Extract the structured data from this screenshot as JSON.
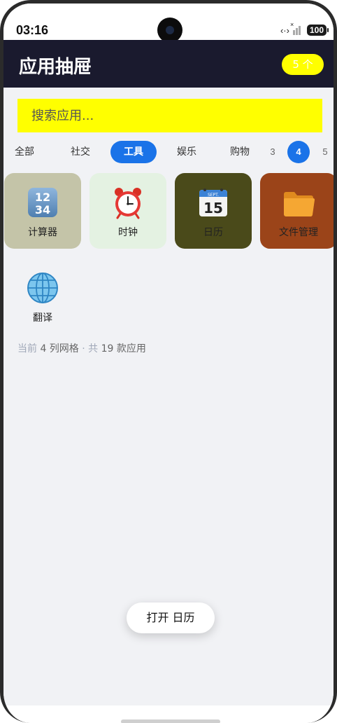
{
  "status_bar": {
    "time": "03:16",
    "battery": "100"
  },
  "header": {
    "title": "应用抽屉",
    "count_badge": "5 个",
    "background": "#1a1a2e",
    "badge_color": "#ffff00"
  },
  "search": {
    "placeholder": "搜索应用...",
    "value": ""
  },
  "categories": {
    "items": [
      "全部",
      "社交",
      "工具",
      "娱乐",
      "购物"
    ],
    "selected": "工具"
  },
  "columns": {
    "options": [
      "3",
      "4",
      "5"
    ],
    "selected": "4"
  },
  "apps": [
    {
      "name": "计算器",
      "icon": "calculator-icon",
      "tile_color": "#c4c4a8"
    },
    {
      "name": "时钟",
      "icon": "alarm-clock-icon",
      "tile_color": "#e4f2e2"
    },
    {
      "name": "日历",
      "icon": "calendar-icon",
      "tile_color": "#4a4a1a",
      "calendar_month": "SEPT.",
      "calendar_day": "15"
    },
    {
      "name": "文件管理",
      "icon": "folder-icon",
      "tile_color": "#9b4419"
    },
    {
      "name": "翻译",
      "icon": "globe-icon",
      "tile_color": "#f1f2f5"
    }
  ],
  "footer": {
    "prefix": "当前",
    "columns_text": "4 列网格",
    "separator": "·",
    "total_prefix": "共",
    "total_text": "19 款应用"
  },
  "toast": {
    "text": "打开 日历"
  },
  "accent_color": "#1a73e8",
  "content_background": "#f1f2f5"
}
